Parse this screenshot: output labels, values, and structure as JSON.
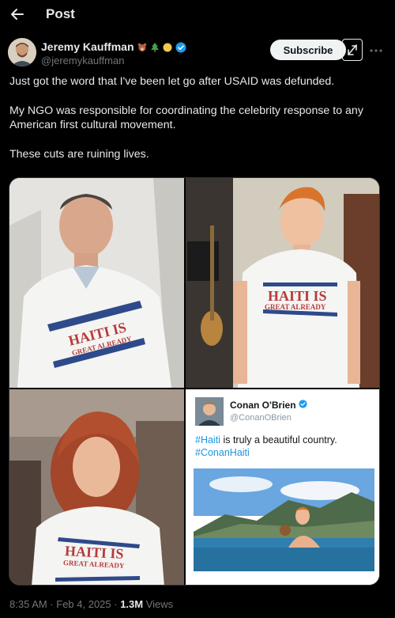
{
  "header": {
    "title": "Post"
  },
  "author": {
    "name": "Jeremy Kauffman",
    "handle": "@jeremykauffman",
    "verified_color": "#1d9bf0"
  },
  "actions": {
    "subscribe_label": "Subscribe"
  },
  "post": {
    "paragraphs": [
      "Just got the word that I've been let go after USAID was defunded.",
      "My NGO was responsible for coordinating the celebrity response to any American first cultural movement.",
      "These cuts are ruining lives."
    ]
  },
  "media": {
    "shirt_line1": "HAITI IS",
    "shirt_line2": "GREAT ALREADY",
    "embedded_tweet": {
      "name": "Conan O'Brien",
      "handle": "@ConanOBrien",
      "hashtag1": "#Haiti",
      "text": " is truly a beautiful country.",
      "hashtag2": "#ConanHaiti"
    }
  },
  "meta": {
    "time": "8:35 AM · Feb 4, 2025 · ",
    "views_count": "1.3M",
    "views_label": " Views"
  }
}
